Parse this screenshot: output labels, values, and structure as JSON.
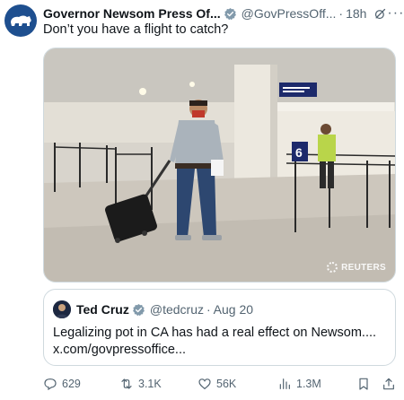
{
  "tweet": {
    "author_name": "Governor Newsom Press Of...",
    "author_handle": "@GovPressOff...",
    "separator": "·",
    "time": "18h",
    "more_glyph": "···",
    "text": "Don’t you have a flight to catch?",
    "media": {
      "credit": "REUTERS"
    }
  },
  "quote": {
    "author_name": "Ted Cruz",
    "author_handle": "@tedcruz",
    "separator": "·",
    "date": "Aug 20",
    "text_line1": "Legalizing pot in CA has had a real effect on Newsom....",
    "text_line2": "x.com/govpressoffice..."
  },
  "actions": {
    "replies": "629",
    "reposts": "3.1K",
    "likes": "56K",
    "views": "1.3M"
  },
  "icons": {
    "verified": "verified-badge-icon",
    "grok": "grok-icon",
    "reply": "reply-icon",
    "repost": "repost-icon",
    "like": "heart-icon",
    "views": "views-icon",
    "bookmark": "bookmark-icon",
    "share": "share-icon"
  },
  "colors": {
    "verified": "#829aab",
    "text": "#0f1419",
    "muted": "#536471",
    "border": "#cfd9de"
  }
}
